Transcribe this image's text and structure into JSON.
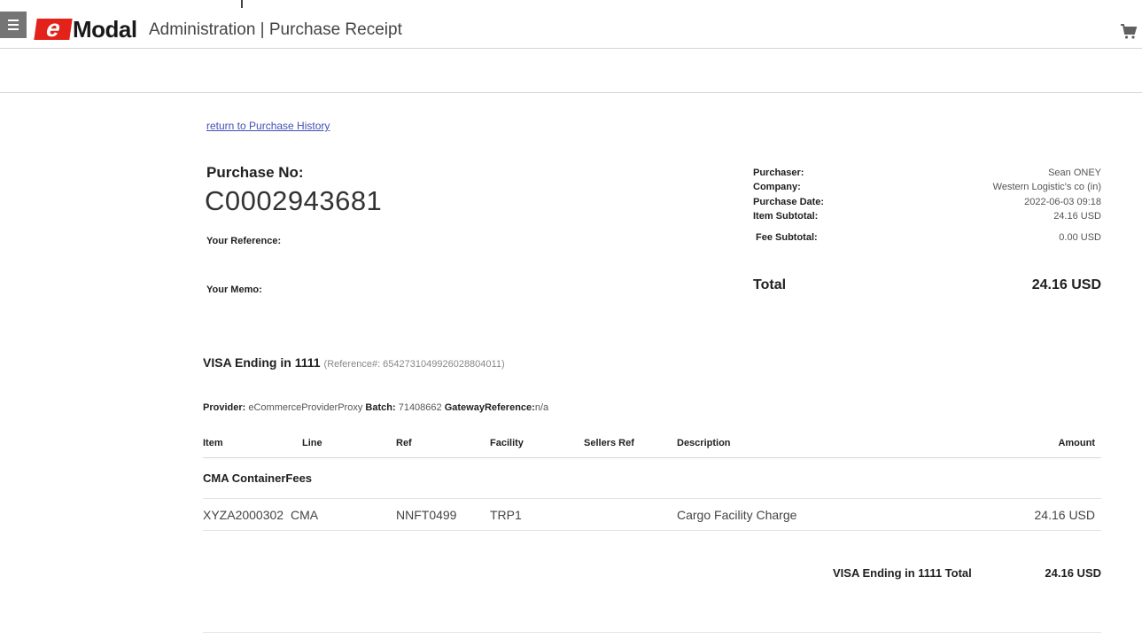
{
  "header": {
    "logo_e": "e",
    "logo_text": "Modal",
    "title": "Administration | Purchase Receipt",
    "menu_icon": "hamburger-icon",
    "cart_icon": "cart-icon"
  },
  "colors": {
    "brand_red": "#e3221a",
    "link": "#3f51b5"
  },
  "receipt": {
    "return_link": "return to Purchase History",
    "purchase_no_label": "Purchase No:",
    "purchase_no": "C0002943681",
    "your_reference_label": "Your Reference:",
    "your_memo_label": "Your Memo:"
  },
  "summary": {
    "purchaser_label": "Purchaser:",
    "purchaser": "Sean ONEY",
    "company_label": "Company:",
    "company": "Western Logistic's co (in)",
    "purchase_date_label": "Purchase Date:",
    "purchase_date": "2022-06-03 09:18",
    "item_subtotal_label": "Item Subtotal:",
    "item_subtotal": "24.16 USD",
    "fee_subtotal_label": "Fee Subtotal:",
    "fee_subtotal": "0.00 USD",
    "total_label": "Total",
    "total": "24.16 USD"
  },
  "payment": {
    "card": "VISA Ending in 1111",
    "reference": "(Reference#: 6542731049926028804011)",
    "provider_label": "Provider:",
    "provider": "eCommerceProviderProxy",
    "batch_label": "Batch:",
    "batch": "71408662",
    "gateway_label": "GatewayReference:",
    "gateway": "n/a"
  },
  "table": {
    "headers": {
      "item": "Item",
      "line": "Line",
      "ref": "Ref",
      "facility": "Facility",
      "sellers_ref": "Sellers Ref",
      "description": "Description",
      "amount": "Amount"
    },
    "group": "CMA ContainerFees",
    "rows": [
      {
        "item": "XYZA2000302",
        "line": "CMA",
        "ref": "NNFT0499",
        "facility": "TRP1",
        "sellers_ref": "",
        "description": "Cargo Facility Charge",
        "amount": "24.16 USD"
      }
    ]
  },
  "card_total": {
    "label": "VISA Ending in 1111 Total",
    "value": "24.16 USD"
  }
}
